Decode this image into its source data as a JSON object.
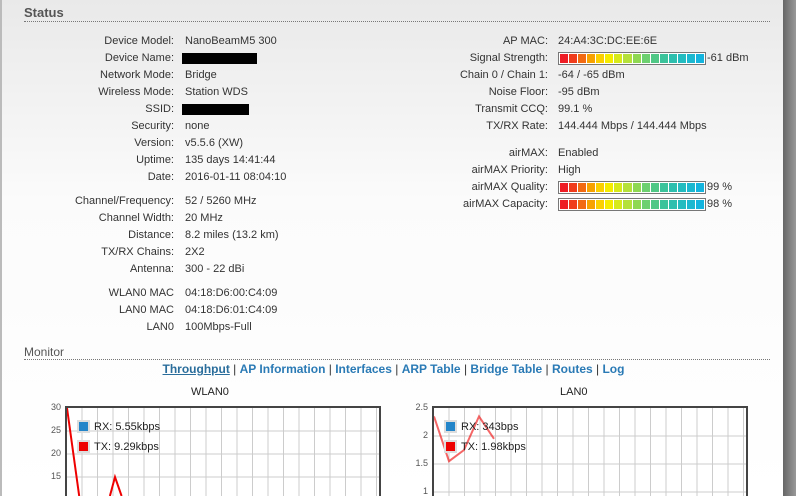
{
  "status": {
    "title": "Status",
    "left": [
      {
        "label": "Device Model:",
        "value": "NanoBeamM5 300"
      },
      {
        "label": "Device Name:",
        "value": null,
        "redacted": true
      },
      {
        "label": "Network Mode:",
        "value": "Bridge"
      },
      {
        "label": "Wireless Mode:",
        "value": "Station WDS"
      },
      {
        "label": "SSID:",
        "value": null,
        "redacted": true
      },
      {
        "label": "Security:",
        "value": "none"
      },
      {
        "label": "Version:",
        "value": "v5.5.6 (XW)"
      },
      {
        "label": "Uptime:",
        "value": "135 days 14:41:44"
      },
      {
        "label": "Date:",
        "value": "2016-01-11 08:04:10"
      },
      {
        "label": "Channel/Frequency:",
        "value": "52 / 5260 MHz"
      },
      {
        "label": "Channel Width:",
        "value": "20 MHz"
      },
      {
        "label": "Distance:",
        "value": "8.2 miles (13.2 km)"
      },
      {
        "label": "TX/RX Chains:",
        "value": "2X2"
      },
      {
        "label": "Antenna:",
        "value": "300 - 22 dBi"
      },
      {
        "label": "WLAN0 MAC",
        "value": "04:18:D6:00:C4:09"
      },
      {
        "label": "LAN0 MAC",
        "value": "04:18:D6:01:C4:09"
      },
      {
        "label": "LAN0",
        "value": "100Mbps-Full"
      }
    ],
    "right": [
      {
        "label": "AP MAC:",
        "value": "24:A4:3C:DC:EE:6E"
      },
      {
        "label": "Signal Strength:",
        "value": "-61 dBm",
        "bar": 1.0
      },
      {
        "label": "Chain 0 / Chain 1:",
        "value": "-64 / -65 dBm"
      },
      {
        "label": "Noise Floor:",
        "value": "-95 dBm"
      },
      {
        "label": "Transmit CCQ:",
        "value": "99.1 %"
      },
      {
        "label": "TX/RX Rate:",
        "value": "144.444 Mbps / 144.444 Mbps"
      },
      {
        "label": "airMAX:",
        "value": "Enabled"
      },
      {
        "label": "airMAX Priority:",
        "value": "High"
      },
      {
        "label": "airMAX Quality:",
        "value": "99 %",
        "bar": 0.99
      },
      {
        "label": "airMAX Capacity:",
        "value": "98 %",
        "bar": 0.98
      }
    ]
  },
  "monitor": {
    "title": "Monitor",
    "tabs": [
      "Throughput",
      "AP Information",
      "Interfaces",
      "ARP Table",
      "Bridge Table",
      "Routes",
      "Log"
    ],
    "active": 0
  },
  "colors": {
    "rx": "#2385c9",
    "tx": "#ee0000",
    "link": "#2a7ab5"
  },
  "charts": [
    {
      "title": "WLAN0",
      "yticks": [
        "30",
        "25",
        "20",
        "15"
      ],
      "ymax": 30,
      "rx": "RX: 5.55kbps",
      "tx": "TX: 9.29kbps",
      "tx_series": [
        30,
        5,
        2,
        15,
        5
      ]
    },
    {
      "title": "LAN0",
      "yticks": [
        "2.5",
        "2",
        "1.5",
        "1"
      ],
      "ymax": 2.5,
      "rx": "RX: 343bps",
      "tx": "TX: 1.98kbps",
      "tx_series": [
        2.35,
        1.55,
        1.75,
        2.35,
        1.95
      ]
    }
  ]
}
